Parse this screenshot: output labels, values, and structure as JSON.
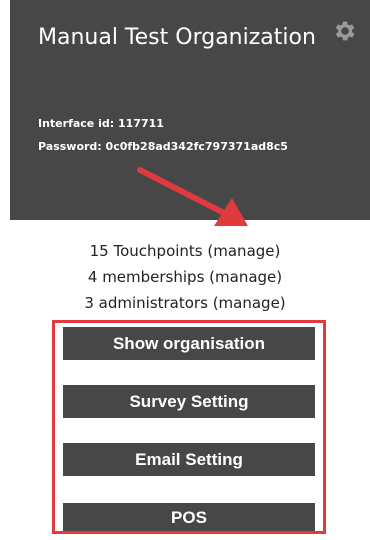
{
  "organization": {
    "name": "Manual Test Organization",
    "interface_id_label": "Interface id:",
    "interface_id_value": "117711",
    "password_label": "Password:",
    "password_value": "0c0fb28ad342fc797371ad8c5"
  },
  "stats": [
    {
      "count": "15",
      "noun": "Touchpoints",
      "link": "(manage)"
    },
    {
      "count": "4",
      "noun": "memberships",
      "link": "(manage)"
    },
    {
      "count": "3",
      "noun": "administrators",
      "link": "(manage)"
    }
  ],
  "actions": {
    "show_organisation": "Show organisation",
    "survey_setting": "Survey Setting",
    "email_setting": "Email Setting",
    "pos": "POS"
  },
  "icons": {
    "settings": "gear-icon"
  },
  "colors": {
    "header_bg": "#474747",
    "button_bg": "#474747",
    "annotation_red": "#e03a3e"
  }
}
